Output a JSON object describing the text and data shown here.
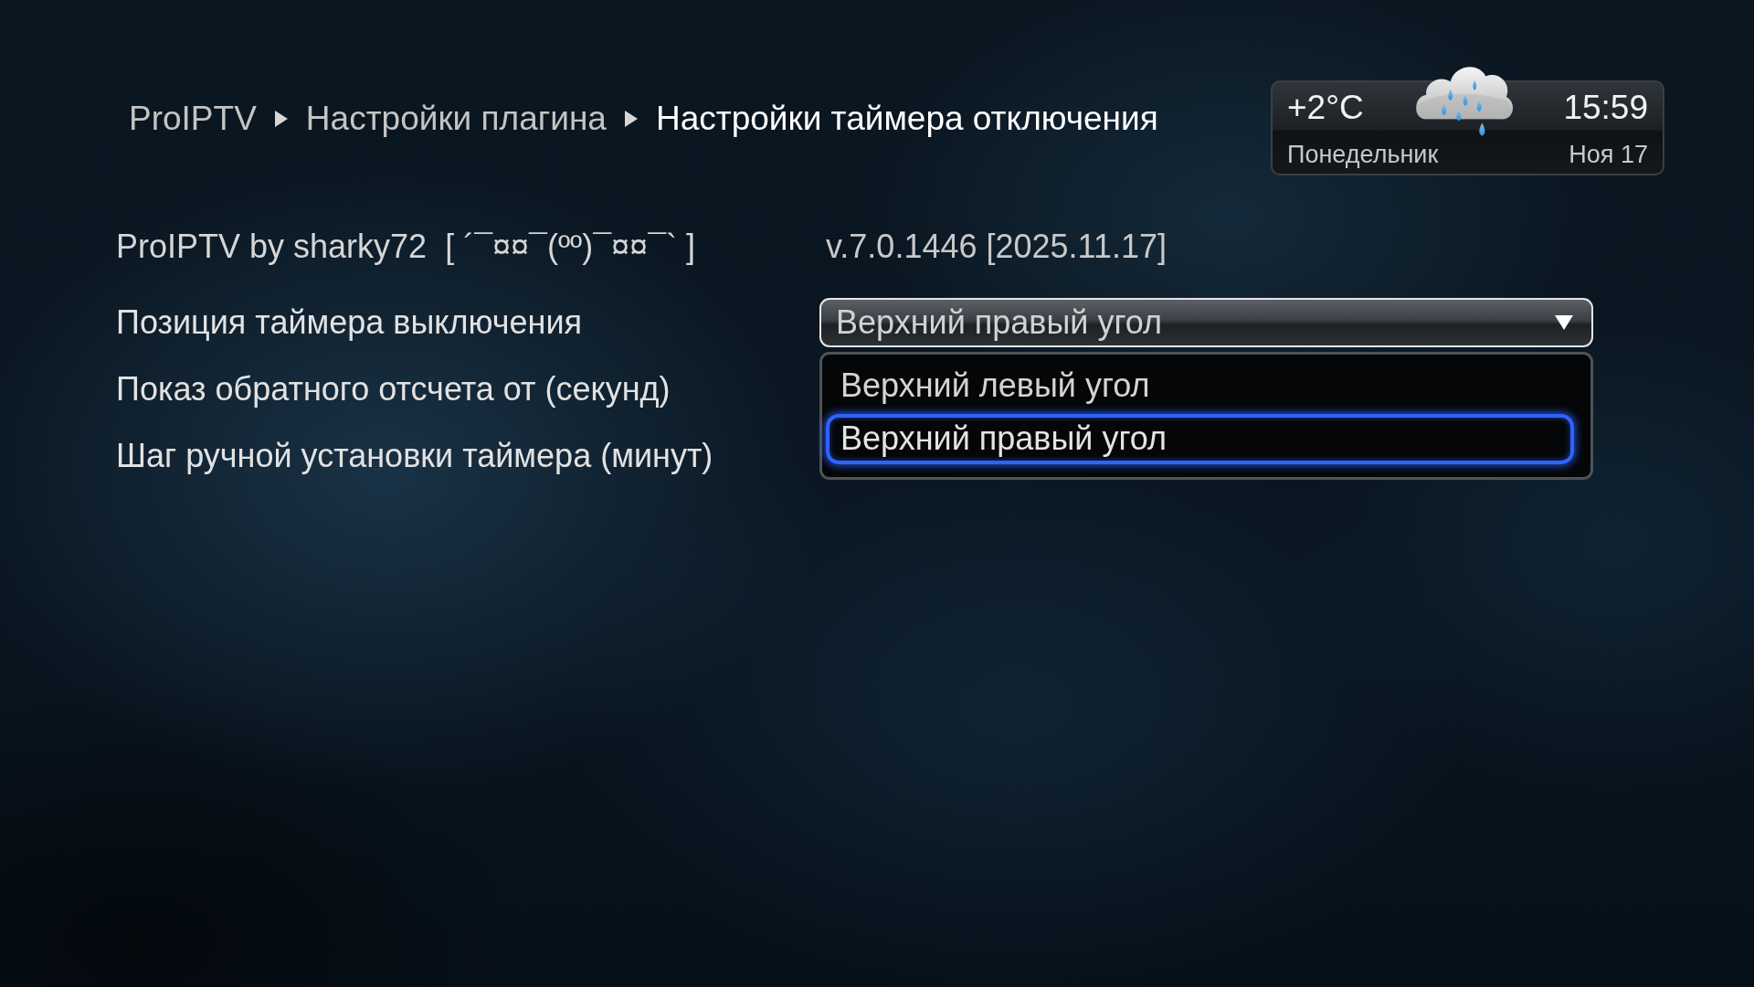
{
  "breadcrumb": [
    {
      "label": "ProIPTV",
      "current": false
    },
    {
      "label": "Настройки плагина",
      "current": false
    },
    {
      "label": "Настройки таймера отключения",
      "current": true
    }
  ],
  "weather": {
    "temperature": "+2°C",
    "time": "15:59",
    "day": "Понедельник",
    "date": "Ноя 17"
  },
  "header": {
    "title": "ProIPTV by sharky72  [ ´¯¤¤¯(ºº)¯¤¤¯` ]",
    "version": "v.7.0.1446 [2025.11.17]"
  },
  "settings": [
    {
      "label": "Позиция таймера выключения",
      "dropdown": {
        "value": "Верхний правый угол",
        "expanded": true,
        "options": [
          {
            "label": "Верхний левый угол",
            "selected": false
          },
          {
            "label": "Верхний правый угол",
            "selected": true
          }
        ]
      }
    },
    {
      "label": "Показ обратного отсчета от (секунд)"
    },
    {
      "label": "Шаг ручной установки таймера (минут)"
    }
  ]
}
